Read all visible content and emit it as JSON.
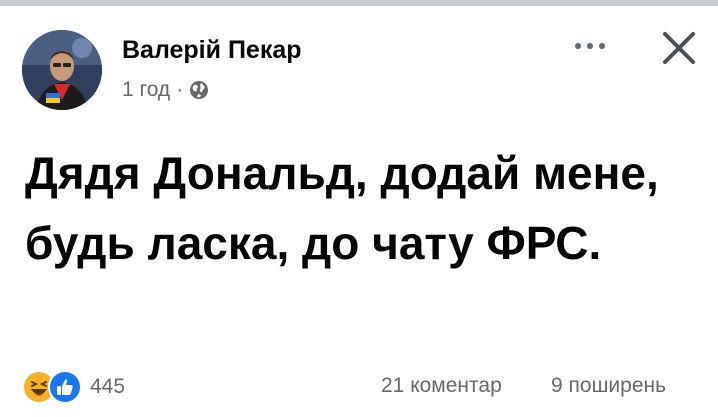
{
  "post": {
    "author_name": "Валерій Пекар",
    "time": "1 год",
    "separator": "·",
    "audience_icon": "globe-icon",
    "text": "Дядя Дональд, додай мене, будь ласка, до чату ФРС."
  },
  "header": {
    "more_icon": "more-dots-icon",
    "close_icon": "close-icon"
  },
  "footer": {
    "reactions": [
      "haha-icon",
      "like-icon"
    ],
    "reaction_count": "445",
    "comments": "21 коментар",
    "shares": "9 поширень"
  },
  "colors": {
    "text_primary": "#050505",
    "text_secondary": "#65676b",
    "like_blue": "#1877f2",
    "haha_yellow": "#f7b125"
  }
}
